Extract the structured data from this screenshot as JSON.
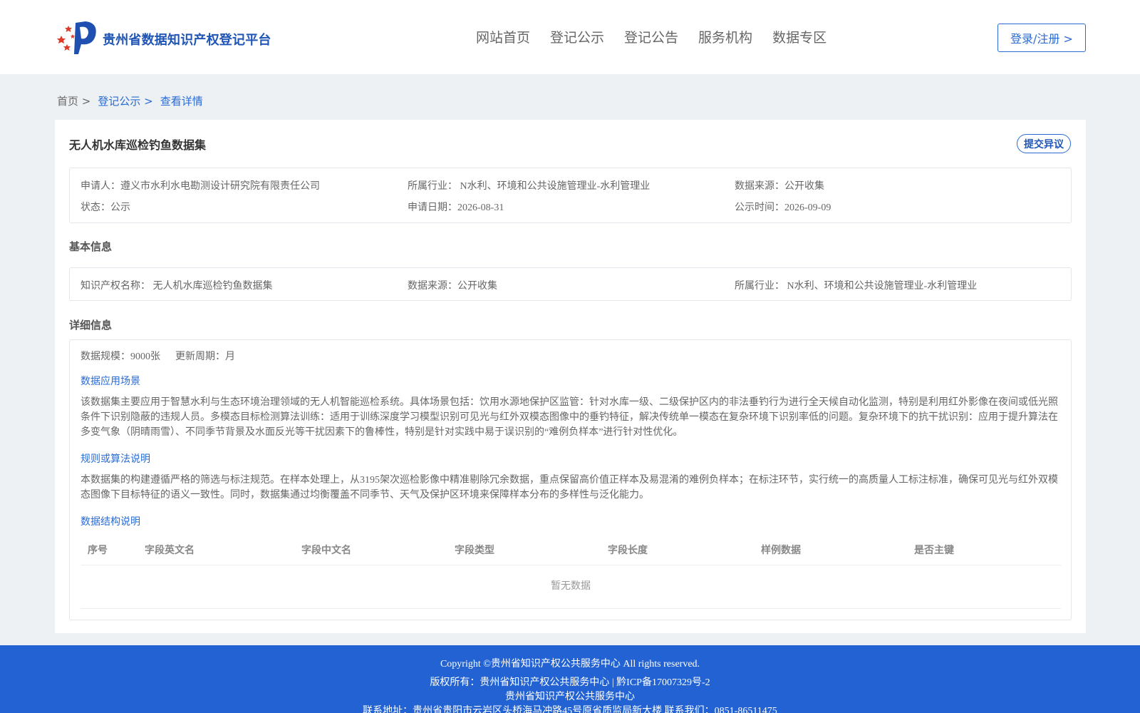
{
  "header": {
    "brand": "贵州省数据知识产权登记平台",
    "nav": [
      "网站首页",
      "登记公示",
      "登记公告",
      "服务机构",
      "数据专区"
    ],
    "login": "登录/注册 >"
  },
  "breadcrumb": {
    "home": "首页 >",
    "list": "登记公示 >",
    "current": "查看详情"
  },
  "detail": {
    "title": "无人机水库巡检钓鱼数据集",
    "objection_button": "提交异议",
    "summary": {
      "applicant": "申请人：遵义市水利水电勘测设计研究院有限责任公司",
      "industry": "所属行业： N水利、环境和公共设施管理业-水利管理业",
      "source": "数据来源：公开收集",
      "status": "状态：公示",
      "apply_date": "申请日期：2026-08-31",
      "publish_date": "公示时间：2026-09-09"
    },
    "basic": {
      "heading": "基本信息",
      "ip_name": "知识产权名称： 无人机水库巡检钓鱼数据集",
      "source": "数据来源：公开收集",
      "industry": "所属行业： N水利、环境和公共设施管理业-水利管理业"
    },
    "details": {
      "heading": "详细信息",
      "scale": "数据规模：9000张",
      "cycle": "更新周期：月",
      "scenario_title": "数据应用场景",
      "scenario_text": "该数据集主要应用于智慧水利与生态环境治理领域的无人机智能巡检系统。具体场景包括：饮用水源地保护区监管：针对水库一级、二级保护区内的非法垂钓行为进行全天候自动化监测，特别是利用红外影像在夜间或低光照条件下识别隐蔽的违规人员。多模态目标检测算法训练：适用于训练深度学习模型识别可见光与红外双模态图像中的垂钓特征，解决传统单一模态在复杂环境下识别率低的问题。复杂环境下的抗干扰识别：应用于提升算法在多变气象（阴晴雨雪）、不同季节背景及水面反光等干扰因素下的鲁棒性，特别是针对实践中易于误识别的“难例负样本”进行针对性优化。",
      "rules_title": "规则或算法说明",
      "rules_text": "本数据集的构建遵循严格的筛选与标注规范。在样本处理上，从3195架次巡检影像中精准剔除冗余数据，重点保留高价值正样本及易混淆的难例负样本；在标注环节，实行统一的高质量人工标注标准，确保可见光与红外双模态图像下目标特征的语义一致性。同时，数据集通过均衡覆盖不同季节、天气及保护区环境来保障样本分布的多样性与泛化能力。",
      "structure_title": "数据结构说明",
      "columns": [
        "序号",
        "字段英文名",
        "字段中文名",
        "字段类型",
        "字段长度",
        "样例数据",
        "是否主键"
      ],
      "empty": "暂无数据"
    }
  },
  "footer": {
    "line1": "Copyright ©贵州省知识产权公共服务中心 All rights reserved.",
    "line2": "版权所有：贵州省知识产权公共服务中心 | 黔ICP备17007329号-2",
    "line3": "贵州省知识产权公共服务中心",
    "line4": "联系地址：贵州省贵阳市云岩区头桥海马冲路45号原省质监局新大楼 联系我们：0851-86511475"
  }
}
